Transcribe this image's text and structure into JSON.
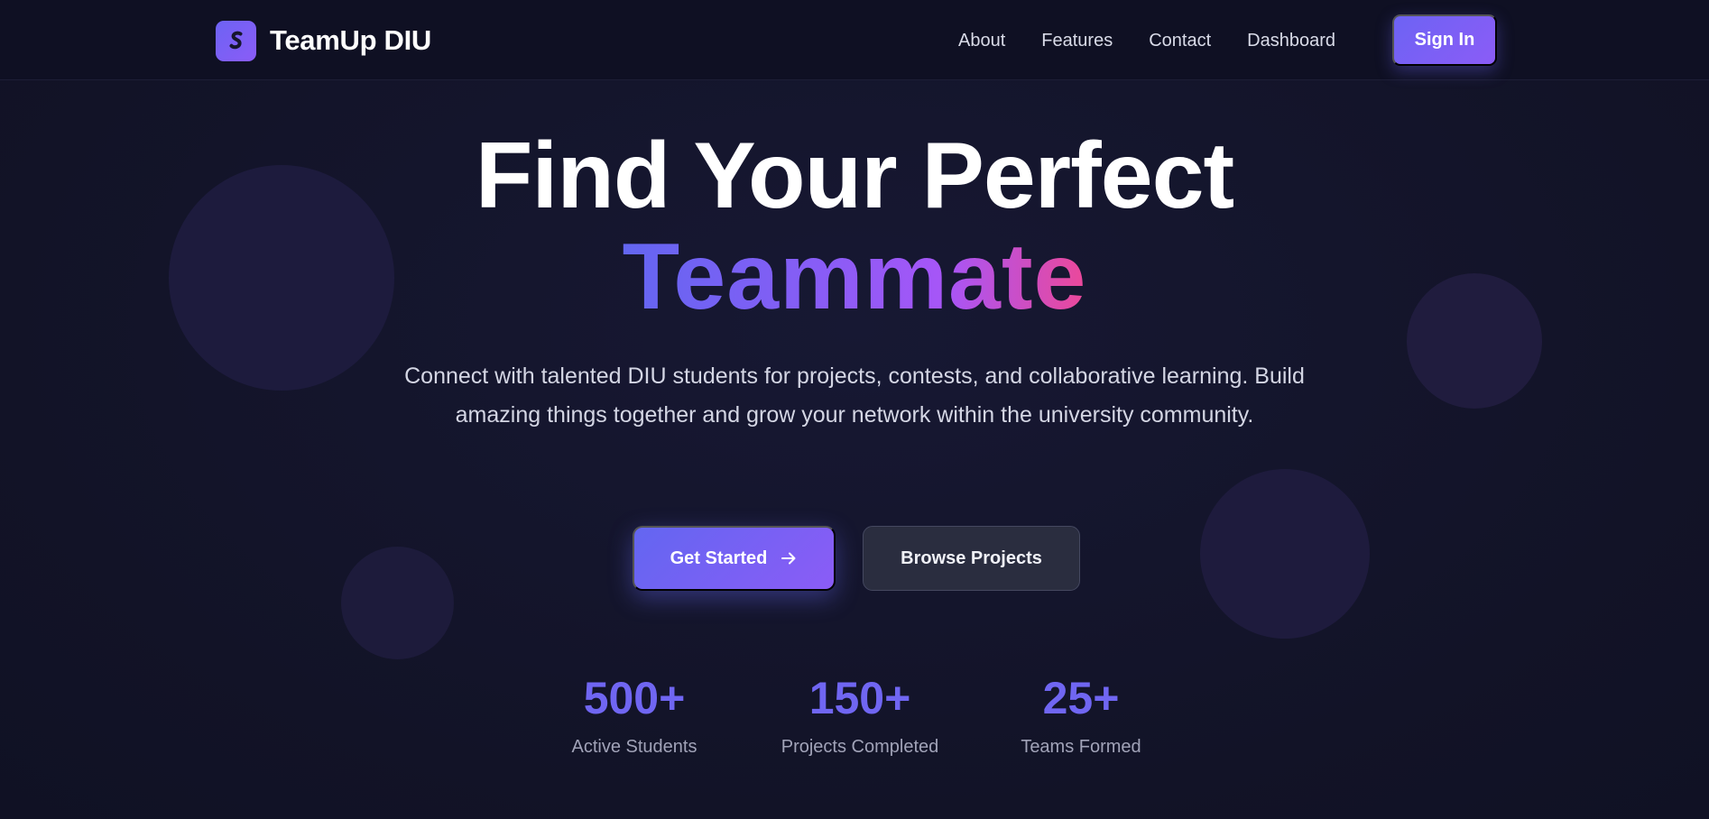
{
  "header": {
    "brand_name": "TeamUp DIU",
    "nav_links": [
      "About",
      "Features",
      "Contact",
      "Dashboard"
    ],
    "sign_in_label": "Sign In",
    "logo_icon": "brand-logo-icon"
  },
  "hero": {
    "title_line1": "Find Your Perfect",
    "title_line2": "Teammate",
    "subtitle": "Connect with talented DIU students for projects, contests, and collaborative learning. Build amazing things together and grow your network within the university community.",
    "primary_button": {
      "label": "Get Started",
      "icon": "arrow-right-icon"
    },
    "secondary_button": {
      "label": "Browse Projects"
    }
  },
  "stats": [
    {
      "value": "500+",
      "label": "Active Students"
    },
    {
      "value": "150+",
      "label": "Projects Completed"
    },
    {
      "value": "25+",
      "label": "Teams Formed"
    }
  ],
  "colors": {
    "background": "#121327",
    "accent": "#6d63f4",
    "accent_gradient_end": "#ec4899",
    "stat_value": "#7066f2"
  }
}
